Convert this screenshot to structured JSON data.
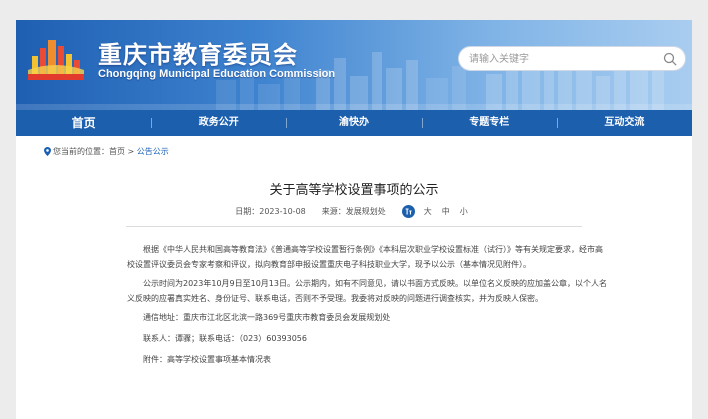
{
  "header": {
    "title_cn": "重庆市教育委员会",
    "title_en": "Chongqing Municipal Education Commission",
    "search_placeholder": "请输入关键字"
  },
  "nav": {
    "items": [
      {
        "label": "首页"
      },
      {
        "label": "政务公开"
      },
      {
        "label": "渝快办"
      },
      {
        "label": "专题专栏"
      },
      {
        "label": "互动交流"
      }
    ]
  },
  "breadcrumb": {
    "prefix": "您当前的位置：",
    "home": "首页",
    "separator": " > ",
    "current": "公告公示"
  },
  "article": {
    "title": "关于高等学校设置事项的公示",
    "date_label": "日期：",
    "date": "2023-10-08",
    "source_label": "来源：",
    "source": "发展规划处",
    "font_sizes": [
      "大",
      "中",
      "小"
    ],
    "paragraphs": [
      "根据《中华人民共和国高等教育法》《普通高等学校设置暂行条例》《本科层次职业学校设置标准（试行）》等有关规定要求，经市高校设置评议委员会专家考察和评议，拟向教育部申报设置重庆电子科技职业大学，现予以公示（基本情况见附件）。",
      "公示时间为2023年10月9日至10月13日。公示期内，如有不同意见，请以书面方式反映。以单位名义反映的应加盖公章，以个人名义反映的应署真实姓名、身份证号、联系电话，否则不予受理。我委将对反映的问题进行调查核实，并为反映人保密。"
    ],
    "address": "通信地址：重庆市江北区北滨一路369号重庆市教育委员会发展规划处",
    "contact": "联系人：谭骤；联系电话：（023）60393056",
    "attachment": "附件：高等学校设置事项基本情况表"
  },
  "colors": {
    "nav_bg": "#1c5fad",
    "accent_link": "#1a5fb4",
    "banner_start": "#1f5fb2",
    "banner_end": "#a9cdf0"
  }
}
